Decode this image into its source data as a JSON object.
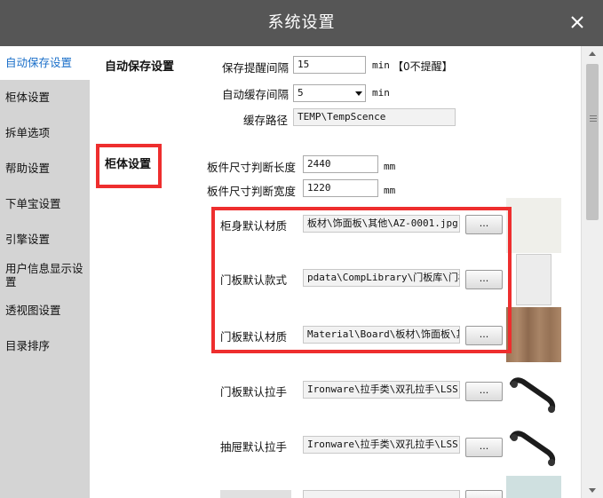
{
  "window": {
    "title": "系统设置"
  },
  "sidebar": {
    "items": [
      {
        "label": "自动保存设置",
        "active": true
      },
      {
        "label": "柜体设置"
      },
      {
        "label": "拆单选项"
      },
      {
        "label": "帮助设置"
      },
      {
        "label": "下单宝设置"
      },
      {
        "label": "引擎设置"
      },
      {
        "label": "用户信息显示设置"
      },
      {
        "label": "透视图设置"
      },
      {
        "label": "目录排序"
      }
    ]
  },
  "autosave": {
    "section_title": "自动保存设置",
    "reminder_label": "保存提醒间隔",
    "reminder_value": "15",
    "reminder_unit": "min",
    "reminder_note": "【0不提醒】",
    "cache_label": "自动缓存间隔",
    "cache_value": "5",
    "cache_unit": "min",
    "path_label": "缓存路径",
    "path_value": "TEMP\\TempScence"
  },
  "cabinet": {
    "section_title": "柜体设置",
    "length_label": "板件尺寸判断长度",
    "length_value": "2440",
    "length_unit": "mm",
    "width_label": "板件尺寸判断宽度",
    "width_value": "1220",
    "width_unit": "mm",
    "browse_label": "...",
    "materials": [
      {
        "label": "柜身默认材质",
        "value": "板材\\饰面板\\其他\\AZ-0001.jpg"
      },
      {
        "label": "门板默认款式",
        "value": "pdata\\CompLibrary\\门板库\\门板"
      },
      {
        "label": "门板默认材质",
        "value": "Material\\Board\\板材\\饰面板\\其"
      },
      {
        "label": "门板默认拉手",
        "value": "Ironware\\拉手类\\双孔拉手\\LSS"
      },
      {
        "label": "抽屉默认拉手",
        "value": "Ironware\\拉手类\\双孔拉手\\LSS"
      }
    ]
  },
  "colors": {
    "titlebar": "#565656",
    "sidebar_bg": "#d4d4d4",
    "active_text": "#1a6fc9",
    "highlight_red": "#ee2e2e"
  },
  "icons": {
    "close": "close-icon",
    "dropdown": "chevron-down-icon"
  }
}
